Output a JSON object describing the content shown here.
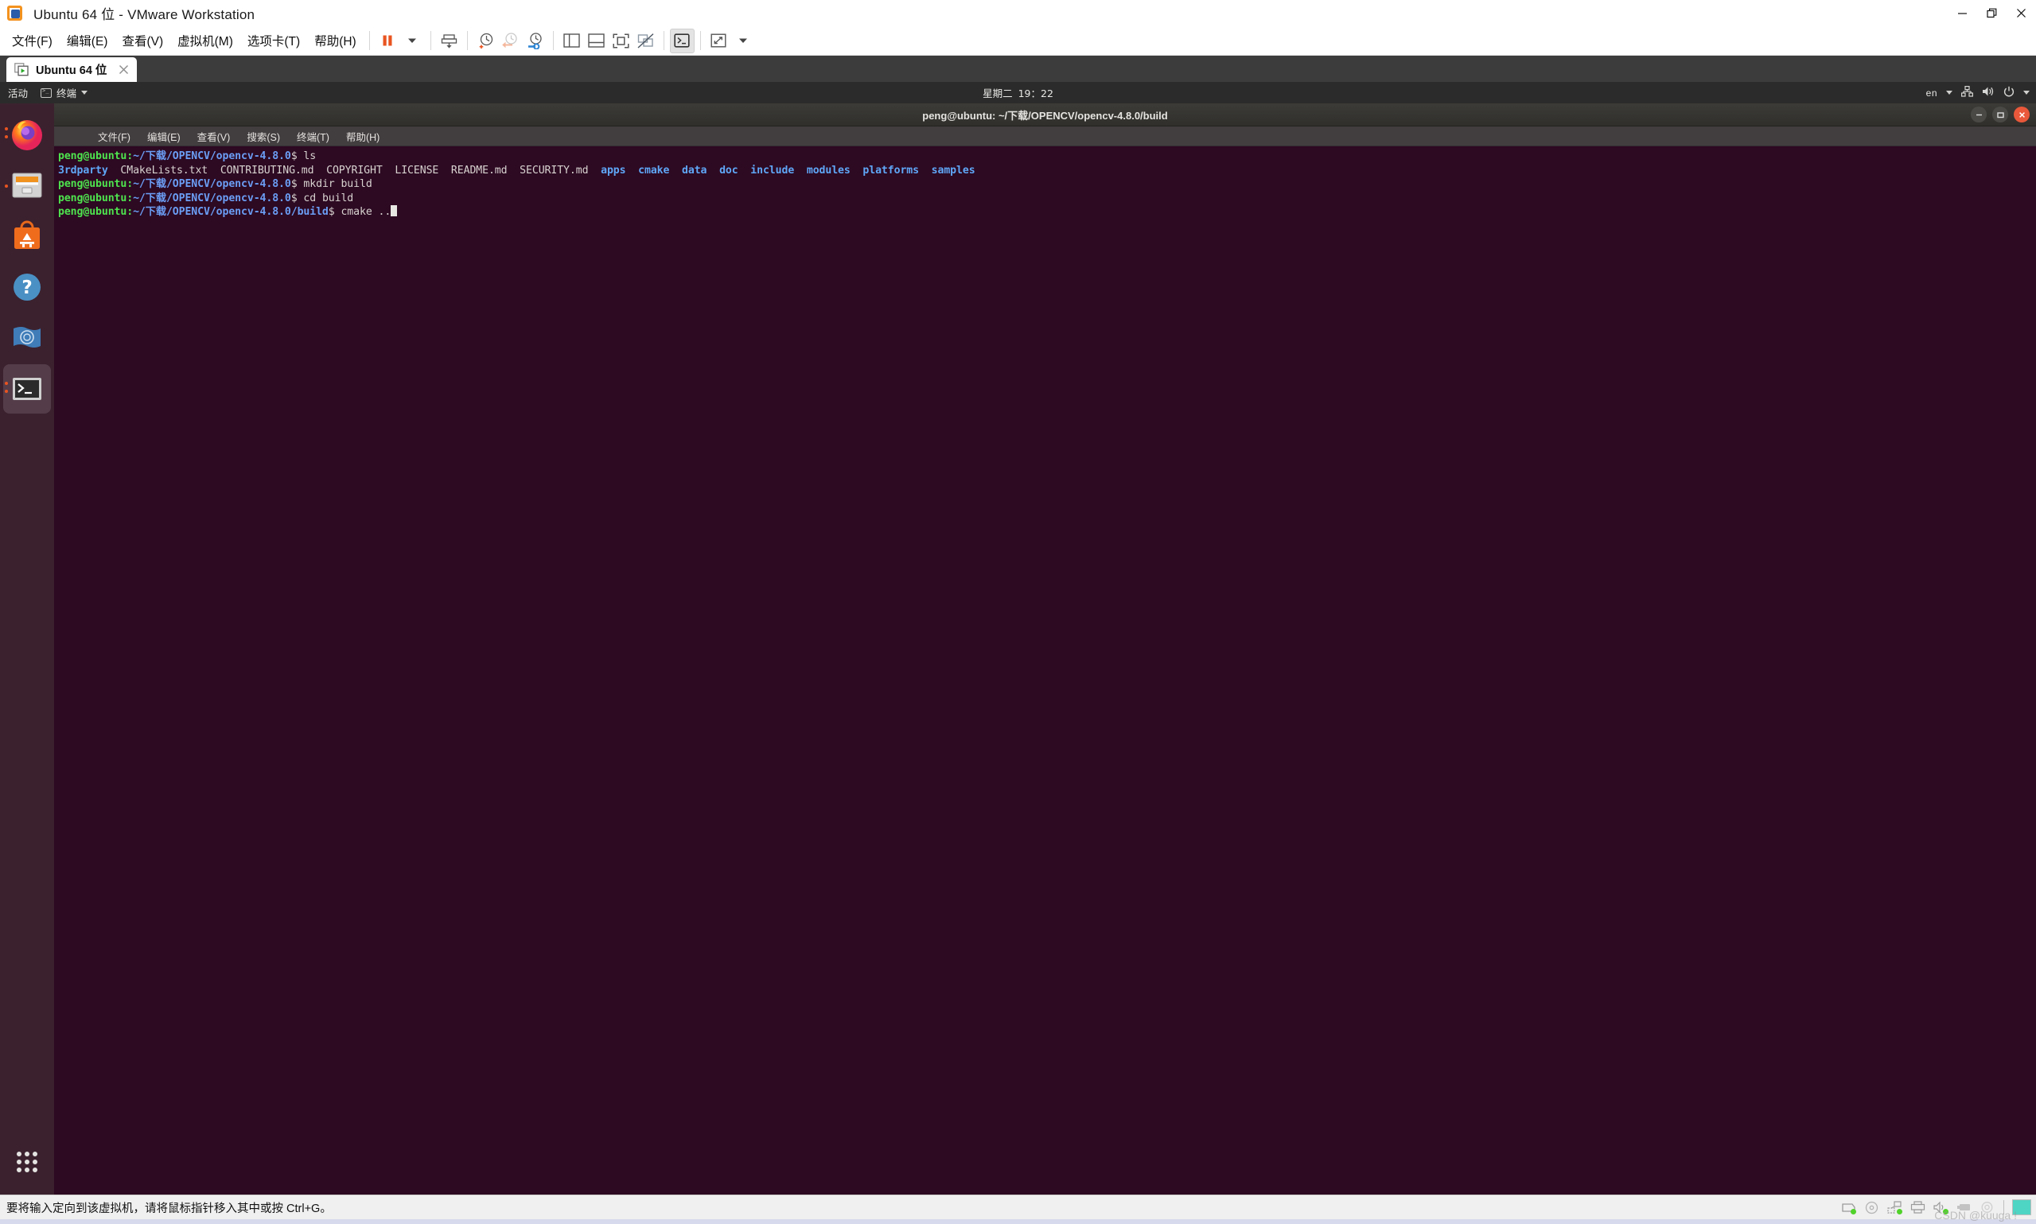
{
  "window": {
    "app_icon": "vmware-logo-icon",
    "title": "Ubuntu 64 位 - VMware Workstation",
    "controls": {
      "minimize": "minimize-icon",
      "restore": "restore-icon",
      "close": "close-icon"
    }
  },
  "menubar": {
    "items": [
      {
        "label": "文件(F)",
        "name": "menu-file"
      },
      {
        "label": "编辑(E)",
        "name": "menu-edit"
      },
      {
        "label": "查看(V)",
        "name": "menu-view"
      },
      {
        "label": "虚拟机(M)",
        "name": "menu-vm"
      },
      {
        "label": "选项卡(T)",
        "name": "menu-tabs"
      },
      {
        "label": "帮助(H)",
        "name": "menu-help"
      }
    ],
    "toolbar": [
      {
        "name": "suspend-button",
        "icon": "pause-icon"
      },
      {
        "name": "power-dropdown",
        "icon": "caret-down-icon"
      },
      {
        "name": "snapshot-manager-button",
        "icon": "snapshot-icon"
      },
      {
        "name": "take-snapshot-button",
        "icon": "clock-plus-icon"
      },
      {
        "name": "revert-snapshot-button",
        "icon": "clock-back-icon"
      },
      {
        "name": "manage-snapshots-button",
        "icon": "clock-wrench-icon"
      },
      {
        "name": "show-library-button",
        "icon": "sidebar-panel-icon"
      },
      {
        "name": "show-thumbnails-button",
        "icon": "bottom-panel-icon"
      },
      {
        "name": "fullscreen-button",
        "icon": "fullscreen-icon"
      },
      {
        "name": "unity-mode-button",
        "icon": "unity-disabled-icon"
      },
      {
        "name": "console-view-button",
        "icon": "terminal-icon"
      },
      {
        "name": "stretch-view-button",
        "icon": "expand-arrows-icon"
      },
      {
        "name": "stretch-dropdown",
        "icon": "caret-down-icon"
      }
    ]
  },
  "tabs": [
    {
      "label": "Ubuntu 64 位",
      "icon": "vm-running-icon",
      "close": "close-icon",
      "active": true
    }
  ],
  "guest": {
    "topbar": {
      "activities": "活动",
      "app_menu": {
        "label": "终端",
        "icon": "terminal-icon",
        "caret": "caret-down-icon"
      },
      "clock": {
        "day": "星期二",
        "time": "19：22"
      },
      "indicators": {
        "keyboard_layout": "en",
        "network": "network-icon",
        "volume": "volume-icon",
        "power": "power-icon",
        "caret": "caret-down-icon"
      }
    },
    "dock": {
      "items": [
        {
          "name": "dock-item-firefox",
          "icon": "firefox-icon",
          "running": true,
          "current": false
        },
        {
          "name": "dock-item-files",
          "icon": "files-icon",
          "running": true,
          "current": false
        },
        {
          "name": "dock-item-ubuntu-software",
          "icon": "ubuntu-software-icon",
          "running": false,
          "current": false
        },
        {
          "name": "dock-item-help",
          "icon": "help-icon",
          "running": false,
          "current": false
        },
        {
          "name": "dock-item-amazon",
          "icon": "flag-icon",
          "running": false,
          "current": false
        },
        {
          "name": "dock-item-terminal",
          "icon": "terminal-icon",
          "running": true,
          "current": true
        }
      ],
      "show_apps": "apps-grid-icon"
    },
    "terminal": {
      "title": "peng@ubuntu: ~/下载/OPENCV/opencv-4.8.0/build",
      "controls": {
        "minimize": "minimize-icon",
        "maximize": "maximize-icon",
        "close": "close-icon"
      },
      "menu": [
        {
          "label": "文件(F)",
          "name": "term-menu-file"
        },
        {
          "label": "编辑(E)",
          "name": "term-menu-edit"
        },
        {
          "label": "查看(V)",
          "name": "term-menu-view"
        },
        {
          "label": "搜索(S)",
          "name": "term-menu-search"
        },
        {
          "label": "终端(T)",
          "name": "term-menu-terminal"
        },
        {
          "label": "帮助(H)",
          "name": "term-menu-help"
        }
      ],
      "lines": [
        {
          "type": "prompt",
          "user": "peng@ubuntu",
          "sep": ":",
          "path": "~/下载/OPENCV/opencv-4.8.0",
          "dollar": "$ ",
          "command": "ls"
        },
        {
          "type": "ls-output",
          "files": [
            "CMakeLists.txt",
            "CONTRIBUTING.md",
            "COPYRIGHT",
            "LICENSE",
            "README.md",
            "SECURITY.md"
          ],
          "first_dir": "3rdparty",
          "dirs": [
            "apps",
            "cmake",
            "data",
            "doc",
            "include",
            "modules",
            "platforms",
            "samples"
          ]
        },
        {
          "type": "prompt",
          "user": "peng@ubuntu",
          "sep": ":",
          "path": "~/下载/OPENCV/opencv-4.8.0",
          "dollar": "$ ",
          "command": "mkdir build"
        },
        {
          "type": "prompt",
          "user": "peng@ubuntu",
          "sep": ":",
          "path": "~/下载/OPENCV/opencv-4.8.0",
          "dollar": "$ ",
          "command": "cd build"
        },
        {
          "type": "prompt-cursor",
          "user": "peng@ubuntu",
          "sep": ":",
          "path": "~/下载/OPENCV/opencv-4.8.0/build",
          "dollar": "$ ",
          "command": "cmake .."
        }
      ]
    }
  },
  "statusbar": {
    "message": "要将输入定向到该虚拟机，请将鼠标指针移入其中或按 Ctrl+G。",
    "icons": [
      {
        "name": "status-harddisk-icon",
        "led": true
      },
      {
        "name": "status-cdrom-icon",
        "led": false
      },
      {
        "name": "status-network-icon",
        "led": true
      },
      {
        "name": "status-printer-icon",
        "led": false
      },
      {
        "name": "status-sound-icon",
        "led": true
      },
      {
        "name": "status-usb-icon",
        "led": false
      },
      {
        "name": "status-camera-icon",
        "led": false
      }
    ],
    "watermark": "CSDN @kuuga !"
  },
  "colors": {
    "accent_orange": "#e95420",
    "terminal_bg": "#2d0922",
    "dock_bg": "#3c242f",
    "topbar_bg": "#2b2b2b",
    "prompt_green": "#4ee44e",
    "path_blue": "#6b9ef5",
    "dir_blue": "#5fa7f7"
  }
}
